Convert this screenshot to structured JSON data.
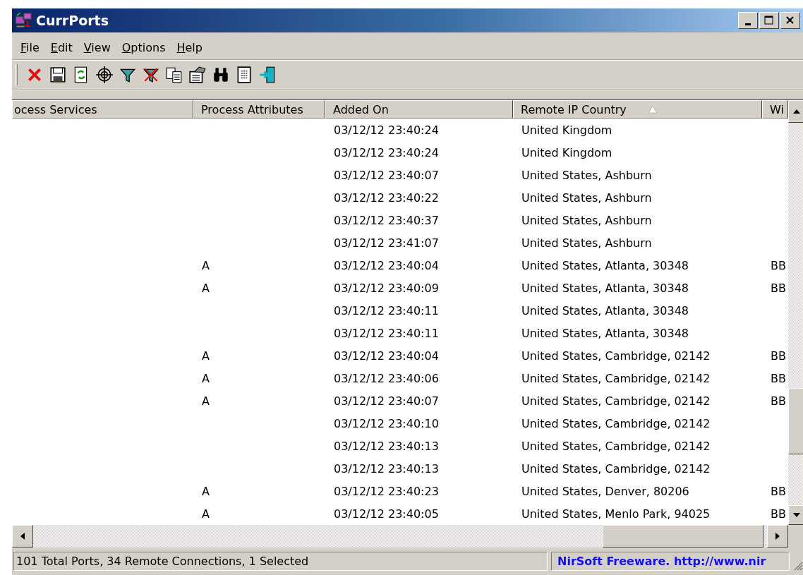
{
  "window": {
    "title": "CurrPorts"
  },
  "menu": [
    {
      "label": "File"
    },
    {
      "label": "Edit"
    },
    {
      "label": "View"
    },
    {
      "label": "Options"
    },
    {
      "label": "Help"
    }
  ],
  "table": {
    "columns": [
      {
        "label": "ocess Services",
        "sorted": false
      },
      {
        "label": "Process Attributes",
        "sorted": false
      },
      {
        "label": "Added On",
        "sorted": false
      },
      {
        "label": "Remote IP Country",
        "sorted": true
      },
      {
        "label": "Wi",
        "sorted": false
      }
    ],
    "rows": [
      {
        "added_on": "03/12/12 23:40:24",
        "remote_ip_country": "United Kingdom"
      },
      {
        "added_on": "03/12/12 23:40:24",
        "remote_ip_country": "United Kingdom"
      },
      {
        "added_on": "03/12/12 23:40:07",
        "remote_ip_country": "United States, Ashburn"
      },
      {
        "added_on": "03/12/12 23:40:22",
        "remote_ip_country": "United States, Ashburn"
      },
      {
        "added_on": "03/12/12 23:40:37",
        "remote_ip_country": "United States, Ashburn"
      },
      {
        "added_on": "03/12/12 23:41:07",
        "remote_ip_country": "United States, Ashburn"
      },
      {
        "process_attributes": "A",
        "added_on": "03/12/12 23:40:04",
        "remote_ip_country": "United States, Atlanta, 30348",
        "column_5": "BB"
      },
      {
        "process_attributes": "A",
        "added_on": "03/12/12 23:40:09",
        "remote_ip_country": "United States, Atlanta, 30348",
        "column_5": "BB"
      },
      {
        "added_on": "03/12/12 23:40:11",
        "remote_ip_country": "United States, Atlanta, 30348"
      },
      {
        "added_on": "03/12/12 23:40:11",
        "remote_ip_country": "United States, Atlanta, 30348"
      },
      {
        "process_attributes": "A",
        "added_on": "03/12/12 23:40:04",
        "remote_ip_country": "United States, Cambridge, 02142",
        "column_5": "BB"
      },
      {
        "process_attributes": "A",
        "added_on": "03/12/12 23:40:06",
        "remote_ip_country": "United States, Cambridge, 02142",
        "column_5": "BB"
      },
      {
        "process_attributes": "A",
        "added_on": "03/12/12 23:40:07",
        "remote_ip_country": "United States, Cambridge, 02142",
        "column_5": "BB"
      },
      {
        "added_on": "03/12/12 23:40:10",
        "remote_ip_country": "United States, Cambridge, 02142"
      },
      {
        "added_on": "03/12/12 23:40:13",
        "remote_ip_country": "United States, Cambridge, 02142"
      },
      {
        "added_on": "03/12/12 23:40:13",
        "remote_ip_country": "United States, Cambridge, 02142"
      },
      {
        "process_attributes": "A",
        "added_on": "03/12/12 23:40:23",
        "remote_ip_country": "United States, Denver, 80206",
        "column_5": "BB"
      },
      {
        "process_attributes": "A",
        "added_on": "03/12/12 23:40:05",
        "remote_ip_country": "United States, Menlo Park, 94025",
        "column_5": "BB"
      }
    ]
  },
  "status_bar": {
    "text": "101 Total Ports, 34 Remote Connections, 1 Selected",
    "link": "NirSoft Freeware.  http://www.nir"
  }
}
